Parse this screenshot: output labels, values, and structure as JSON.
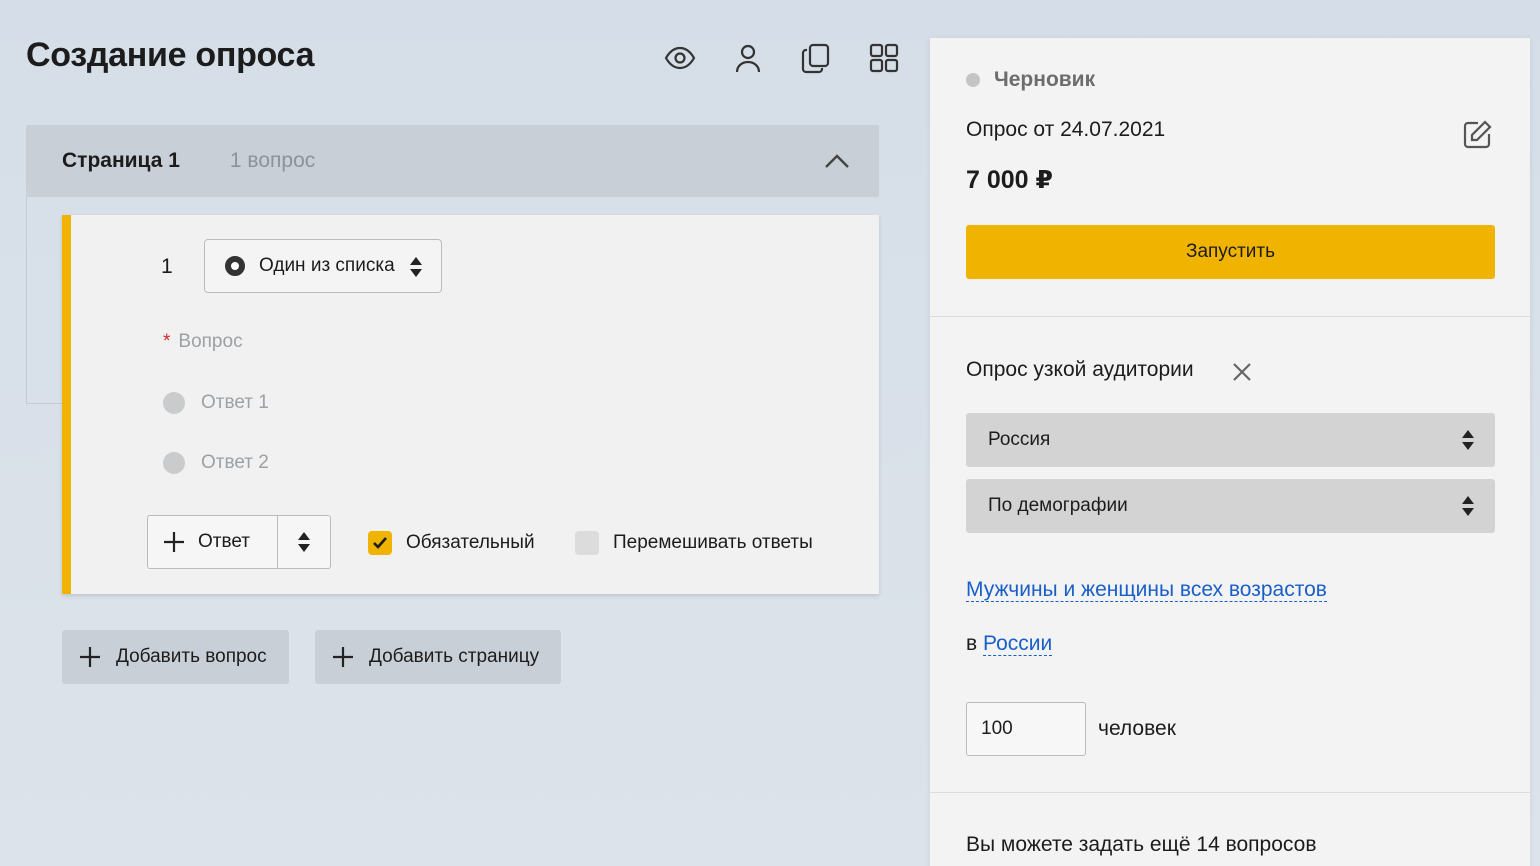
{
  "header": {
    "title": "Создание опроса",
    "toolbar": [
      {
        "icon": "eye-icon"
      },
      {
        "icon": "user-icon"
      },
      {
        "icon": "copy-icon"
      },
      {
        "icon": "grid-icon"
      }
    ]
  },
  "page": {
    "title": "Страница 1",
    "question_count": "1 вопрос"
  },
  "question": {
    "number": "1",
    "type_label": "Один из списка",
    "question_placeholder": "Вопрос",
    "answers": [
      "Ответ 1",
      "Ответ 2"
    ],
    "add_answer_label": "Ответ",
    "required_label": "Обязательный",
    "required_checked": true,
    "shuffle_label": "Перемешивать ответы",
    "shuffle_checked": false
  },
  "actions": {
    "add_question": "Добавить вопрос",
    "add_page": "Добавить страницу"
  },
  "panel": {
    "status": "Черновик",
    "survey_name": "Опрос от 24.07.2021",
    "price": "7 000 ₽",
    "launch_label": "Запустить",
    "audience_title": "Опрос узкой аудитории",
    "region_select": "Россия",
    "filter_select": "По демографии",
    "demographic_link": "Мужчины и женщины всех возрастов",
    "in_prefix": "в",
    "region_link": "России",
    "respondents_value": "100",
    "respondents_unit": "человек",
    "questions_left": "Вы можете задать ещё 14 вопросов"
  },
  "colors": {
    "accent": "#f0b400",
    "link": "#1a5fc8",
    "required_star": "#d62828"
  }
}
